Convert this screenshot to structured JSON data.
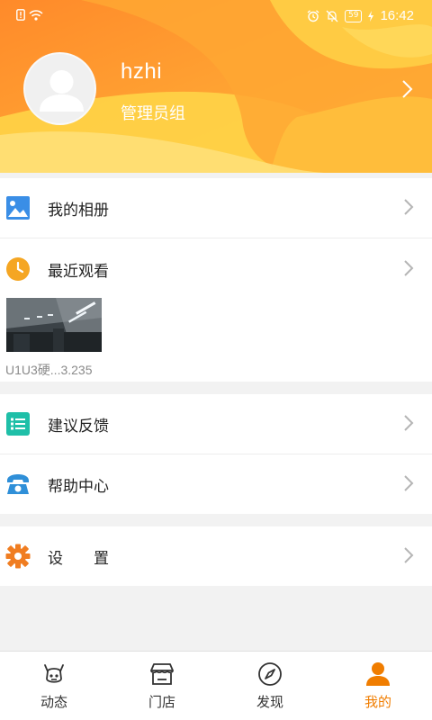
{
  "status_bar": {
    "time": "16:42",
    "battery": "59",
    "icons": [
      "sim-alert-icon",
      "wifi-icon",
      "alarm-icon",
      "mute-icon",
      "battery-icon",
      "charging-icon"
    ]
  },
  "profile": {
    "username": "hzhi",
    "group": "管理员组"
  },
  "menu": {
    "album": {
      "label": "我的相册",
      "icon": "image-icon",
      "color": "#3a8ee6"
    },
    "recent": {
      "label": "最近观看",
      "icon": "clock-icon",
      "color": "#f5a623"
    },
    "recent_item": {
      "caption": "U1U3硬...3.235"
    },
    "feedback": {
      "label": "建议反馈",
      "icon": "list-icon",
      "color": "#1fbfa8"
    },
    "help": {
      "label": "帮助中心",
      "icon": "phone-icon",
      "color": "#2f8fd8"
    },
    "settings": {
      "label": "设　　置",
      "icon": "gear-icon",
      "color": "#f07d21"
    }
  },
  "tabs": [
    {
      "label": "动态",
      "icon": "feed-icon",
      "active": false
    },
    {
      "label": "门店",
      "icon": "store-icon",
      "active": false
    },
    {
      "label": "发现",
      "icon": "compass-icon",
      "active": false
    },
    {
      "label": "我的",
      "icon": "person-icon",
      "active": true
    }
  ],
  "colors": {
    "accent": "#f07d00",
    "header_gradient": [
      "#ff9a2e",
      "#ffd23f"
    ]
  }
}
